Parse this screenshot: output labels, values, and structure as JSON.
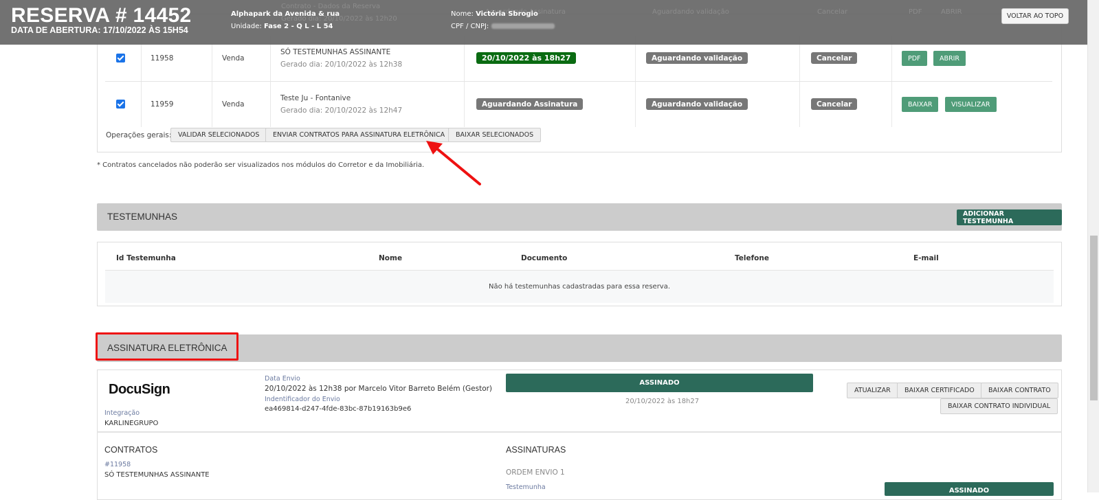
{
  "header": {
    "title": "RESERVA # 14452",
    "abertura": "DATA DE ABERTURA: 17/10/2022 ÀS 15H54",
    "empreendimento": "Alphapark da Avenida & rua",
    "unidade_label": "Unidade:",
    "unidade": "Fase 2 - Q L - L 54",
    "nome_label": "Nome:",
    "nome": "Victória Sbrogio",
    "cpf_label": "CPF / CNPJ:",
    "back_to_top": "VOLTAR AO TOPO"
  },
  "ghost_row": {
    "descricao": "Contrato - Dados da Reserva",
    "gerado": "Gerado dia: 20/10/2022 às 12h20",
    "status": "Aguardando Assinatura",
    "validacao": "Aguardando validação",
    "cancelar": "Cancelar",
    "pdf": "PDF",
    "abrir": "ABRIR"
  },
  "contracts": [
    {
      "id": "11958",
      "tipo": "Venda",
      "descricao": "SÓ TESTEMUNHAS ASSINANTE",
      "gerado": "Gerado dia: 20/10/2022 às 12h38",
      "status": "20/10/2022 às 18h27",
      "validacao": "Aguardando validação",
      "cancelar": "Cancelar",
      "btn1": "PDF",
      "btn2": "ABRIR"
    },
    {
      "id": "11959",
      "tipo": "Venda",
      "descricao": "Teste Ju - Fontanive",
      "gerado": "Gerado dia: 20/10/2022 às 12h47",
      "status": "Aguardando Assinatura",
      "validacao": "Aguardando validação",
      "cancelar": "Cancelar",
      "btn1": "BAIXAR",
      "btn2": "VISUALIZAR"
    }
  ],
  "operations": {
    "label": "Operações gerais:",
    "validar": "VALIDAR SELECIONADOS",
    "enviar": "ENVIAR CONTRATOS PARA ASSINATURA ELETRÔNICA",
    "baixar": "BAIXAR SELECIONADOS"
  },
  "note": "* Contratos cancelados não poderão ser visualizados nos módulos do Corretor e da Imobiliária.",
  "testemunhas": {
    "title": "TESTEMUNHAS",
    "add_button": "ADICIONAR TESTEMUNHA",
    "columns": [
      "Id Testemunha",
      "Nome",
      "Documento",
      "Telefone",
      "E-mail"
    ],
    "empty": "Não há testemunhas cadastradas para essa reserva."
  },
  "assinatura": {
    "title": "ASSINATURA ELETRÔNICA",
    "provider": "DocuSign",
    "integracao_label": "Integração",
    "integracao": "KARLINEGRUPO",
    "data_envio_label": "Data Envio",
    "data_envio": "20/10/2022 às 12h38 por Marcelo Vitor Barreto Belém (Gestor)",
    "identificador_label": "Indentificador do Envio",
    "identificador": "ea469814-d247-4fde-83bc-87b19163b9e6",
    "status": "ASSINADO",
    "status_date": "20/10/2022 às 18h27",
    "buttons": {
      "atualizar": "ATUALIZAR",
      "certificado": "BAIXAR CERTIFICADO",
      "contrato": "BAIXAR CONTRATO",
      "individual": "BAIXAR CONTRATO INDIVIDUAL"
    },
    "contratos_title": "CONTRATOS",
    "contrato_id": "#11958",
    "contrato_nome": "SÓ TESTEMUNHAS ASSINANTE",
    "assinaturas_title": "ASSINATURAS",
    "ordem": "ORDEM ENVIO 1",
    "signer_role": "Testemunha",
    "signer_status": "ASSINADO"
  },
  "colors": {
    "sticky_header": "#696969",
    "signed_green": "#0a6b12",
    "dark_teal": "#2c6a5a",
    "button_green": "#4f9c78",
    "annotation_red": "#ee1111"
  }
}
